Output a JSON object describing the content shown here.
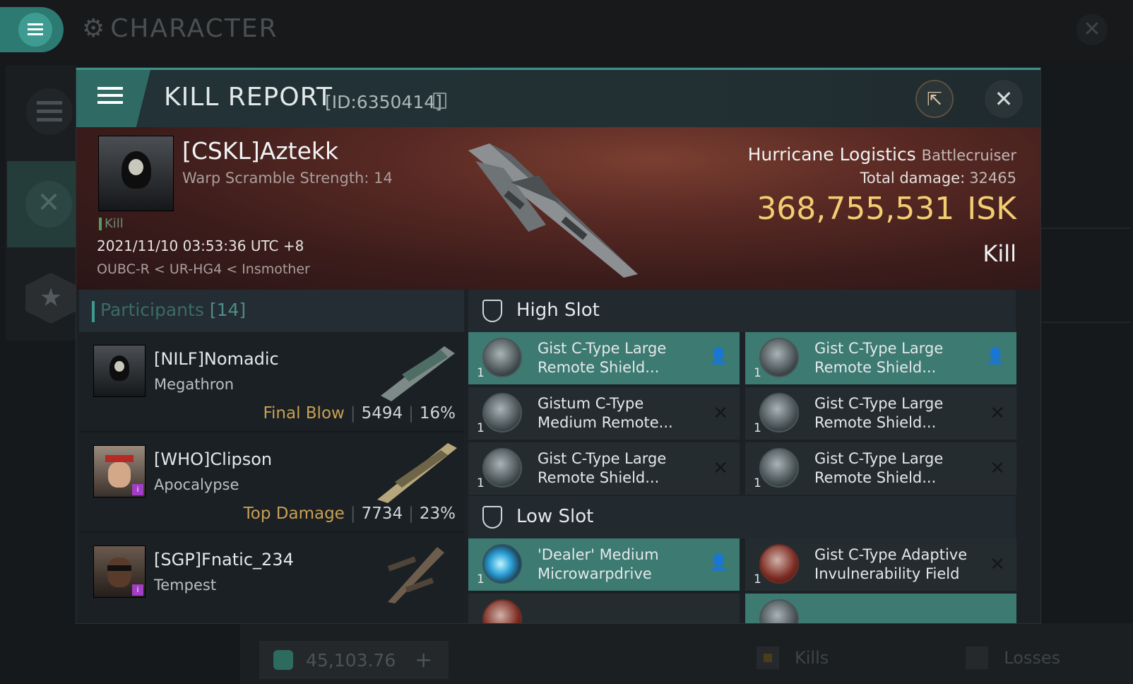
{
  "background": {
    "title": "CHARACTER",
    "wallet_value": "45,103.76",
    "legend": [
      "Kills",
      "Losses"
    ]
  },
  "modal": {
    "title": "KILL REPORT",
    "id_label": "[ID:6350414]"
  },
  "victim": {
    "name": "[CSKL]Aztekk",
    "warp_scramble": "Warp Scramble Strength: 14",
    "kill_tag": "Kill",
    "datetime": "2021/11/10 03:53:36 UTC +8",
    "location": "OUBC-R < UR-HG4 < Insmother",
    "ship_name": "Hurricane Logistics",
    "ship_class": "Battlecruiser",
    "total_damage_label": "Total damage:",
    "total_damage": "32465",
    "isk_value": "368,755,531",
    "isk_unit": "ISK",
    "result": "Kill"
  },
  "participants": {
    "title": "Participants",
    "count": "[14]",
    "rows": [
      {
        "name": "[NILF]Nomadic",
        "ship": "Megathron",
        "tag": "Final Blow",
        "damage": "5494",
        "percent": "16%"
      },
      {
        "name": "[WHO]Clipson",
        "ship": "Apocalypse",
        "tag": "Top Damage",
        "damage": "7734",
        "percent": "23%"
      },
      {
        "name": "[SGP]Fnatic_234",
        "ship": "Tempest",
        "tag": "",
        "damage": "",
        "percent": ""
      }
    ]
  },
  "slots": {
    "high_title": "High Slot",
    "low_title": "Low Slot",
    "high": [
      {
        "qty": "1",
        "name": "Gist C-Type Large Remote Shield...",
        "state": "person"
      },
      {
        "qty": "1",
        "name": "Gist C-Type Large Remote Shield...",
        "state": "person"
      },
      {
        "qty": "1",
        "name": "Gistum C-Type Medium Remote...",
        "state": "x"
      },
      {
        "qty": "1",
        "name": "Gist C-Type Large Remote Shield...",
        "state": "x"
      },
      {
        "qty": "1",
        "name": "Gist C-Type Large Remote Shield...",
        "state": "x"
      },
      {
        "qty": "1",
        "name": "Gist C-Type Large Remote Shield...",
        "state": "x"
      }
    ],
    "low": [
      {
        "qty": "1",
        "name": "'Dealer' Medium Microwarpdrive",
        "state": "person"
      },
      {
        "qty": "1",
        "name": "Gist C-Type Adaptive Invulnerability Field",
        "state": "x"
      }
    ]
  },
  "colors": {
    "accent": "#3d7a72",
    "isk": "#f2cd72",
    "tag_gold": "#c8a052"
  }
}
